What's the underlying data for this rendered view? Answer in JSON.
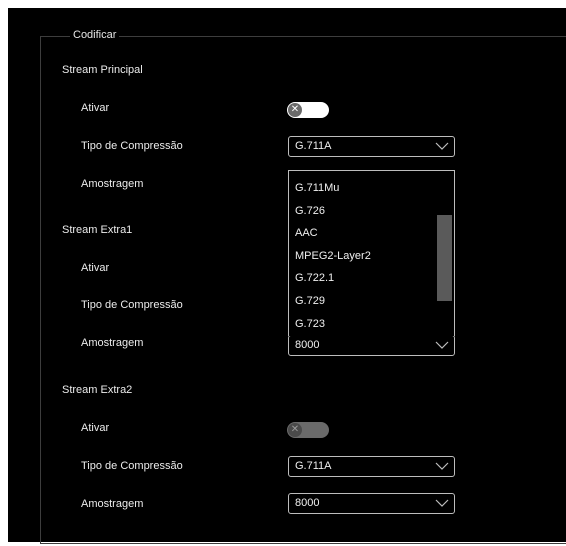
{
  "legend": "Codificar",
  "streams": [
    {
      "title": "Stream Principal",
      "enable_label": "Ativar",
      "enabled": true,
      "compression_label": "Tipo de Compressão",
      "compression_value": "G.711A",
      "sampling_label": "Amostragem",
      "sampling_value": ""
    },
    {
      "title": "Stream Extra1",
      "enable_label": "Ativar",
      "compression_label": "Tipo de Compressão",
      "sampling_label": "Amostragem",
      "sampling_value": "8000"
    },
    {
      "title": "Stream Extra2",
      "enable_label": "Ativar",
      "enabled": false,
      "compression_label": "Tipo de Compressão",
      "compression_value": "G.711A",
      "sampling_label": "Amostragem",
      "sampling_value": "8000"
    }
  ],
  "dropdown_options": [
    "G.711Mu",
    "G.726",
    "AAC",
    "MPEG2-Layer2",
    "G.722.1",
    "G.729",
    "G.723"
  ],
  "icons": {
    "toggle_knob": "close-icon",
    "select_arrow": "chevron-down-icon"
  },
  "colors": {
    "background": "#000000",
    "text": "#ececec",
    "toggle_on": "#ffffff",
    "toggle_off": "#6a6a6a",
    "border": "#bdbdbd"
  }
}
